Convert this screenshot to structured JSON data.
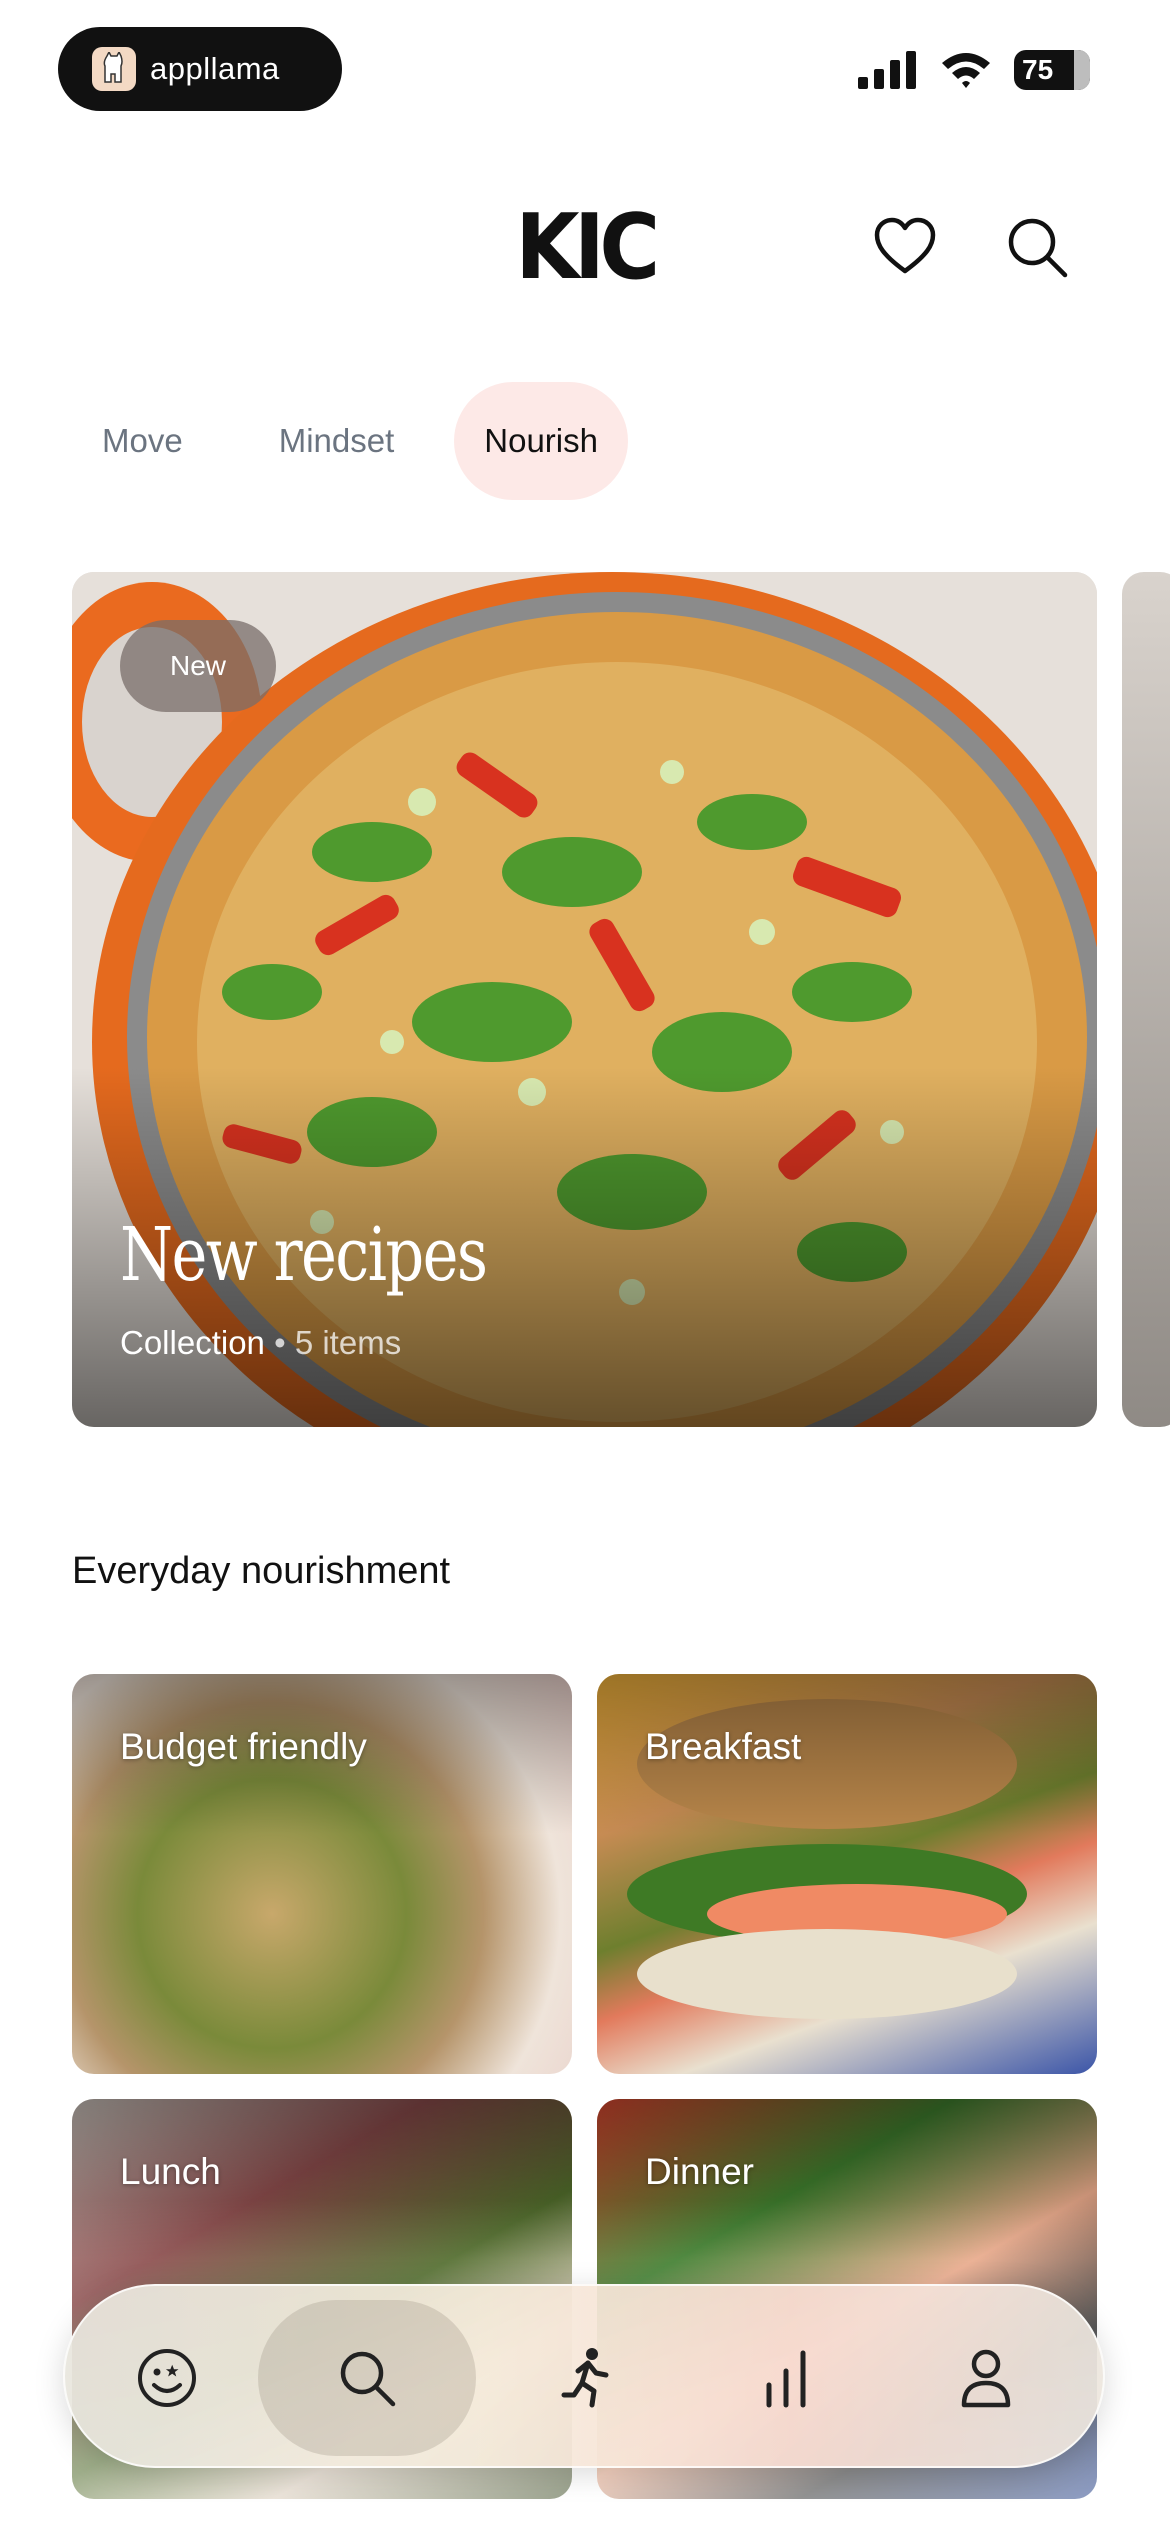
{
  "status_bar": {
    "brand": "appllama",
    "battery": "75"
  },
  "header": {
    "logo": "KIC"
  },
  "tabs": [
    {
      "label": "Move",
      "active": false
    },
    {
      "label": "Mindset",
      "active": false
    },
    {
      "label": "Nourish",
      "active": true
    }
  ],
  "hero": {
    "badge": "New",
    "title": "New recipes",
    "type": "Collection",
    "separator": "•",
    "count": "5 items"
  },
  "section": {
    "title": "Everyday nourishment",
    "tiles": [
      {
        "label": "Budget friendly"
      },
      {
        "label": "Breakfast"
      },
      {
        "label": "Lunch"
      },
      {
        "label": "Dinner"
      }
    ]
  },
  "bottom_nav": {
    "items": [
      {
        "icon": "smiley-icon",
        "active": false
      },
      {
        "icon": "search-icon",
        "active": true
      },
      {
        "icon": "running-icon",
        "active": false
      },
      {
        "icon": "bar-chart-icon",
        "active": false
      },
      {
        "icon": "profile-icon",
        "active": false
      }
    ]
  },
  "colors": {
    "active_tab_bg": "#fde9e7",
    "inactive_tab_text": "#6b7480",
    "text": "#111111"
  }
}
